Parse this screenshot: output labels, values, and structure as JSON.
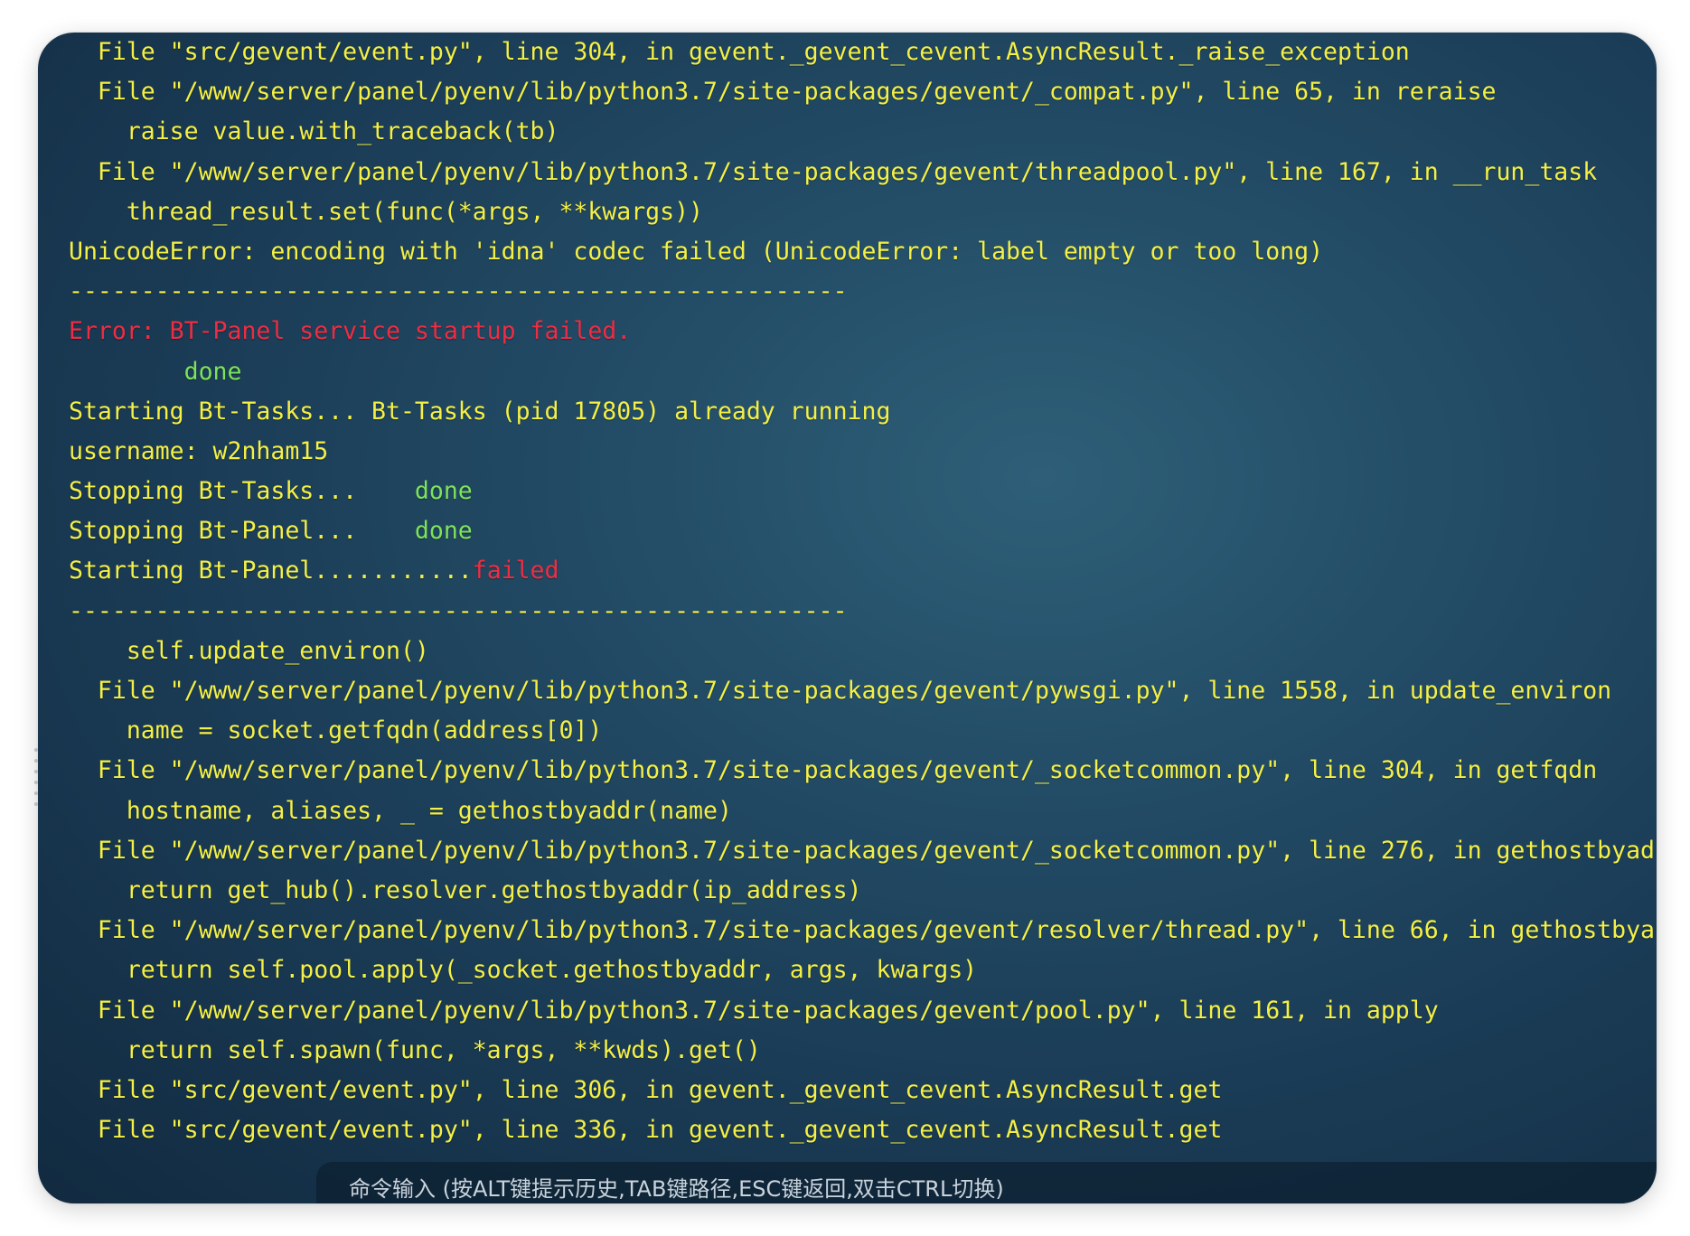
{
  "terminal": {
    "lines": [
      {
        "parts": [
          {
            "text": "  File \"src/gevent/event.py\", line 304, in gevent._gevent_cevent.AsyncResult._raise_exception",
            "color": "yellow"
          }
        ]
      },
      {
        "parts": [
          {
            "text": "  File \"/www/server/panel/pyenv/lib/python3.7/site-packages/gevent/_compat.py\", line 65, in reraise",
            "color": "yellow"
          }
        ]
      },
      {
        "parts": [
          {
            "text": "    raise value.with_traceback(tb)",
            "color": "yellow"
          }
        ]
      },
      {
        "parts": [
          {
            "text": "  File \"/www/server/panel/pyenv/lib/python3.7/site-packages/gevent/threadpool.py\", line 167, in __run_task",
            "color": "yellow"
          }
        ]
      },
      {
        "parts": [
          {
            "text": "    thread_result.set(func(*args, **kwargs))",
            "color": "yellow"
          }
        ]
      },
      {
        "parts": [
          {
            "text": "UnicodeError: encoding with 'idna' codec failed (UnicodeError: label empty or too long)",
            "color": "yellow"
          }
        ]
      },
      {
        "parts": [
          {
            "text": "------------------------------------------------------",
            "color": "yellow"
          }
        ]
      },
      {
        "parts": [
          {
            "text": "Error: BT-Panel service startup failed.",
            "color": "red"
          }
        ]
      },
      {
        "parts": [
          {
            "text": "        done",
            "color": "green"
          }
        ]
      },
      {
        "parts": [
          {
            "text": "Starting Bt-Tasks... Bt-Tasks (pid 17805) already running",
            "color": "yellow"
          }
        ]
      },
      {
        "parts": [
          {
            "text": "username: w2nham15",
            "color": "yellow"
          }
        ]
      },
      {
        "parts": [
          {
            "text": "Stopping Bt-Tasks...    ",
            "color": "yellow"
          },
          {
            "text": "done",
            "color": "green"
          }
        ]
      },
      {
        "parts": [
          {
            "text": "Stopping Bt-Panel...    ",
            "color": "yellow"
          },
          {
            "text": "done",
            "color": "green"
          }
        ]
      },
      {
        "parts": [
          {
            "text": "Starting Bt-Panel...........",
            "color": "yellow"
          },
          {
            "text": "failed",
            "color": "red"
          }
        ]
      },
      {
        "parts": [
          {
            "text": "------------------------------------------------------",
            "color": "yellow"
          }
        ]
      },
      {
        "parts": [
          {
            "text": "    self.update_environ()",
            "color": "yellow"
          }
        ]
      },
      {
        "parts": [
          {
            "text": "  File \"/www/server/panel/pyenv/lib/python3.7/site-packages/gevent/pywsgi.py\", line 1558, in update_environ",
            "color": "yellow"
          }
        ]
      },
      {
        "parts": [
          {
            "text": "    name = socket.getfqdn(address[0])",
            "color": "yellow"
          }
        ]
      },
      {
        "parts": [
          {
            "text": "  File \"/www/server/panel/pyenv/lib/python3.7/site-packages/gevent/_socketcommon.py\", line 304, in getfqdn",
            "color": "yellow"
          }
        ]
      },
      {
        "parts": [
          {
            "text": "    hostname, aliases, _ = gethostbyaddr(name)",
            "color": "yellow"
          }
        ]
      },
      {
        "parts": [
          {
            "text": "  File \"/www/server/panel/pyenv/lib/python3.7/site-packages/gevent/_socketcommon.py\", line 276, in gethostbyad",
            "color": "yellow"
          }
        ]
      },
      {
        "parts": [
          {
            "text": "    return get_hub().resolver.gethostbyaddr(ip_address)",
            "color": "yellow"
          }
        ]
      },
      {
        "parts": [
          {
            "text": "  File \"/www/server/panel/pyenv/lib/python3.7/site-packages/gevent/resolver/thread.py\", line 66, in gethostbya",
            "color": "yellow"
          }
        ]
      },
      {
        "parts": [
          {
            "text": "    return self.pool.apply(_socket.gethostbyaddr, args, kwargs)",
            "color": "yellow"
          }
        ]
      },
      {
        "parts": [
          {
            "text": "  File \"/www/server/panel/pyenv/lib/python3.7/site-packages/gevent/pool.py\", line 161, in apply",
            "color": "yellow"
          }
        ]
      },
      {
        "parts": [
          {
            "text": "    return self.spawn(func, *args, **kwds).get()",
            "color": "yellow"
          }
        ]
      },
      {
        "parts": [
          {
            "text": "  File \"src/gevent/event.py\", line 306, in gevent._gevent_cevent.AsyncResult.get",
            "color": "yellow"
          }
        ]
      },
      {
        "parts": [
          {
            "text": "  File \"src/gevent/event.py\", line 336, in gevent._gevent_cevent.AsyncResult.get",
            "color": "yellow"
          }
        ]
      }
    ]
  },
  "command_bar": {
    "placeholder": "命令输入 (按ALT键提示历史,TAB键路径,ESC键返回,双击CTRL切换)"
  },
  "colors": {
    "yellow": "#f4f046",
    "red": "#ee2d43",
    "green": "#7ee35a",
    "background": "#1b3c56"
  }
}
